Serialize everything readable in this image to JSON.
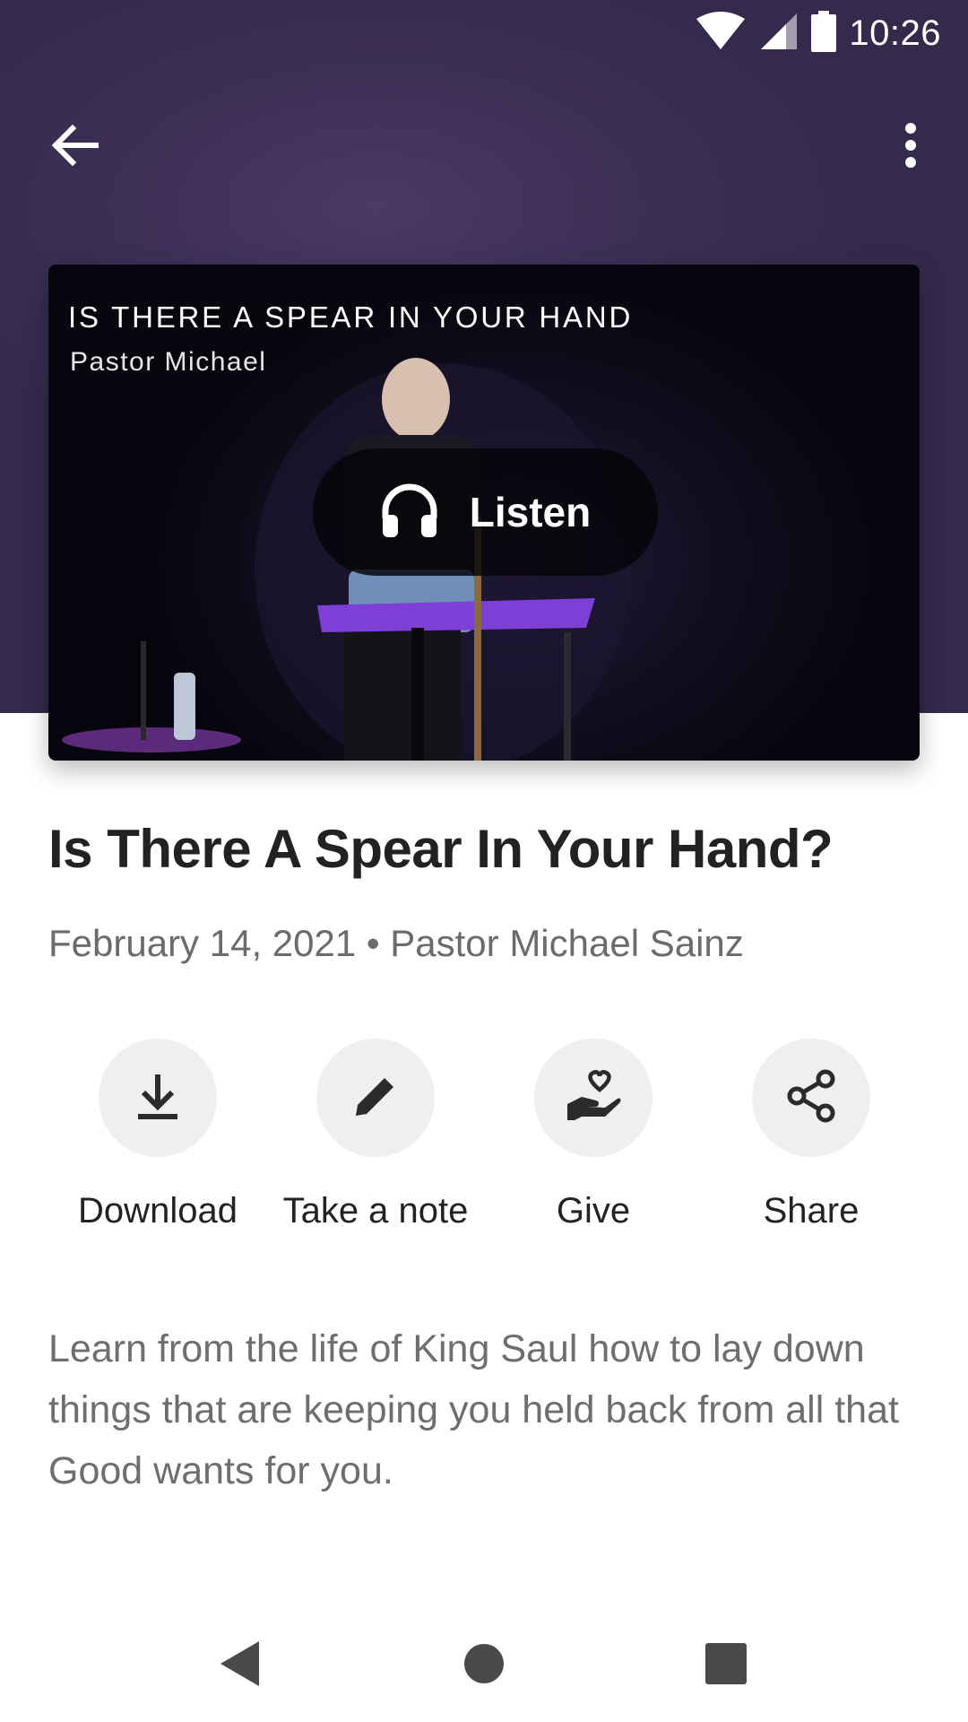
{
  "status_bar": {
    "time": "10:26",
    "icons": [
      "wifi-icon",
      "signal-icon",
      "battery-icon"
    ]
  },
  "toolbar": {
    "back_icon": "arrow-left-icon",
    "more_icon": "more-vertical-icon"
  },
  "media": {
    "overlay_title": "IS THERE A SPEAR IN YOUR HAND",
    "overlay_subtitle": "Pastor Michael",
    "listen_label": "Listen",
    "listen_icon": "headphones-icon"
  },
  "sermon": {
    "title": "Is There A Spear In Your Hand?",
    "meta": "February 14, 2021 • Pastor Michael Sainz",
    "description": "Learn from the life of King Saul how to lay down things that are keeping you held back from all that Good wants for you."
  },
  "actions": [
    {
      "label": "Download",
      "icon": "download-icon"
    },
    {
      "label": "Take a note",
      "icon": "pencil-icon"
    },
    {
      "label": "Give",
      "icon": "give-heart-hand-icon"
    },
    {
      "label": "Share",
      "icon": "share-icon"
    }
  ],
  "navigation": {
    "buttons": [
      "back-triangle-icon",
      "home-circle-icon",
      "recents-square-icon"
    ]
  },
  "colors": {
    "header_background": "#3e3057",
    "title_text": "#222222",
    "meta_text": "#6b6b6b",
    "action_circle": "#efeff0"
  }
}
